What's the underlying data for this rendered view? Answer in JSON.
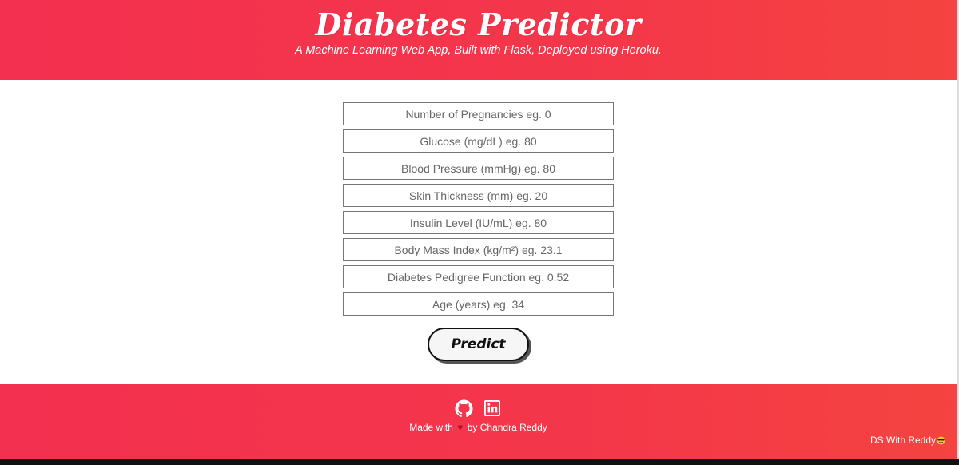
{
  "header": {
    "title": "Diabetes Predictor",
    "subtitle": "A Machine Learning Web App, Built with Flask, Deployed using Heroku."
  },
  "form": {
    "fields": [
      {
        "placeholder": "Number of Pregnancies eg. 0",
        "value": ""
      },
      {
        "placeholder": "Glucose (mg/dL) eg. 80",
        "value": ""
      },
      {
        "placeholder": "Blood Pressure (mmHg) eg. 80",
        "value": ""
      },
      {
        "placeholder": "Skin Thickness (mm) eg. 20",
        "value": ""
      },
      {
        "placeholder": "Insulin Level (IU/mL) eg. 80",
        "value": ""
      },
      {
        "placeholder": "Body Mass Index (kg/m²) eg. 23.1",
        "value": ""
      },
      {
        "placeholder": "Diabetes Pedigree Function eg. 0.52",
        "value": ""
      },
      {
        "placeholder": "Age (years) eg. 34",
        "value": ""
      }
    ],
    "predict_label": "Predict"
  },
  "footer": {
    "icons": [
      "github-icon",
      "linkedin-icon"
    ],
    "made_with_prefix": "Made with",
    "heart_glyph": "♥",
    "made_with_suffix": "by Chandra Reddy",
    "brand": "DS With Reddy"
  },
  "colors": {
    "header_gradient_start": "#f3304f",
    "header_gradient_end": "#f44340",
    "heart": "#b3121f"
  }
}
